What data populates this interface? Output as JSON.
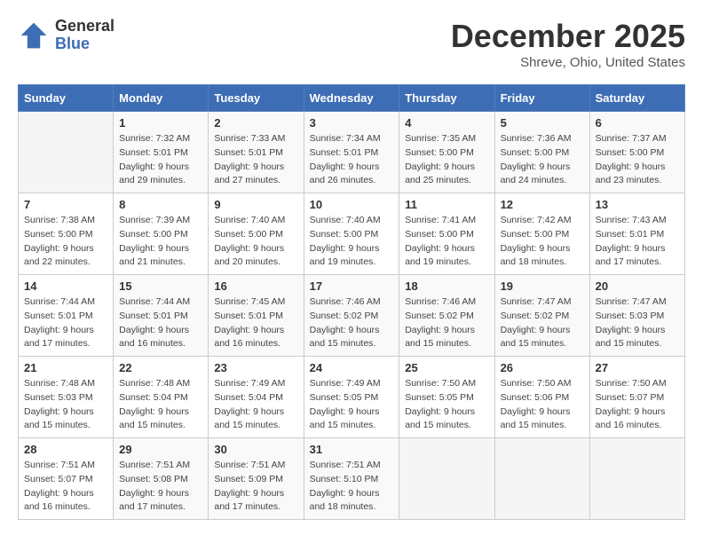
{
  "header": {
    "logo_line1": "General",
    "logo_line2": "Blue",
    "month": "December 2025",
    "location": "Shreve, Ohio, United States"
  },
  "weekdays": [
    "Sunday",
    "Monday",
    "Tuesday",
    "Wednesday",
    "Thursday",
    "Friday",
    "Saturday"
  ],
  "weeks": [
    [
      {
        "day": "",
        "sunrise": "",
        "sunset": "",
        "daylight": ""
      },
      {
        "day": "1",
        "sunrise": "Sunrise: 7:32 AM",
        "sunset": "Sunset: 5:01 PM",
        "daylight": "Daylight: 9 hours and 29 minutes."
      },
      {
        "day": "2",
        "sunrise": "Sunrise: 7:33 AM",
        "sunset": "Sunset: 5:01 PM",
        "daylight": "Daylight: 9 hours and 27 minutes."
      },
      {
        "day": "3",
        "sunrise": "Sunrise: 7:34 AM",
        "sunset": "Sunset: 5:01 PM",
        "daylight": "Daylight: 9 hours and 26 minutes."
      },
      {
        "day": "4",
        "sunrise": "Sunrise: 7:35 AM",
        "sunset": "Sunset: 5:00 PM",
        "daylight": "Daylight: 9 hours and 25 minutes."
      },
      {
        "day": "5",
        "sunrise": "Sunrise: 7:36 AM",
        "sunset": "Sunset: 5:00 PM",
        "daylight": "Daylight: 9 hours and 24 minutes."
      },
      {
        "day": "6",
        "sunrise": "Sunrise: 7:37 AM",
        "sunset": "Sunset: 5:00 PM",
        "daylight": "Daylight: 9 hours and 23 minutes."
      }
    ],
    [
      {
        "day": "7",
        "sunrise": "Sunrise: 7:38 AM",
        "sunset": "Sunset: 5:00 PM",
        "daylight": "Daylight: 9 hours and 22 minutes."
      },
      {
        "day": "8",
        "sunrise": "Sunrise: 7:39 AM",
        "sunset": "Sunset: 5:00 PM",
        "daylight": "Daylight: 9 hours and 21 minutes."
      },
      {
        "day": "9",
        "sunrise": "Sunrise: 7:40 AM",
        "sunset": "Sunset: 5:00 PM",
        "daylight": "Daylight: 9 hours and 20 minutes."
      },
      {
        "day": "10",
        "sunrise": "Sunrise: 7:40 AM",
        "sunset": "Sunset: 5:00 PM",
        "daylight": "Daylight: 9 hours and 19 minutes."
      },
      {
        "day": "11",
        "sunrise": "Sunrise: 7:41 AM",
        "sunset": "Sunset: 5:00 PM",
        "daylight": "Daylight: 9 hours and 19 minutes."
      },
      {
        "day": "12",
        "sunrise": "Sunrise: 7:42 AM",
        "sunset": "Sunset: 5:00 PM",
        "daylight": "Daylight: 9 hours and 18 minutes."
      },
      {
        "day": "13",
        "sunrise": "Sunrise: 7:43 AM",
        "sunset": "Sunset: 5:01 PM",
        "daylight": "Daylight: 9 hours and 17 minutes."
      }
    ],
    [
      {
        "day": "14",
        "sunrise": "Sunrise: 7:44 AM",
        "sunset": "Sunset: 5:01 PM",
        "daylight": "Daylight: 9 hours and 17 minutes."
      },
      {
        "day": "15",
        "sunrise": "Sunrise: 7:44 AM",
        "sunset": "Sunset: 5:01 PM",
        "daylight": "Daylight: 9 hours and 16 minutes."
      },
      {
        "day": "16",
        "sunrise": "Sunrise: 7:45 AM",
        "sunset": "Sunset: 5:01 PM",
        "daylight": "Daylight: 9 hours and 16 minutes."
      },
      {
        "day": "17",
        "sunrise": "Sunrise: 7:46 AM",
        "sunset": "Sunset: 5:02 PM",
        "daylight": "Daylight: 9 hours and 15 minutes."
      },
      {
        "day": "18",
        "sunrise": "Sunrise: 7:46 AM",
        "sunset": "Sunset: 5:02 PM",
        "daylight": "Daylight: 9 hours and 15 minutes."
      },
      {
        "day": "19",
        "sunrise": "Sunrise: 7:47 AM",
        "sunset": "Sunset: 5:02 PM",
        "daylight": "Daylight: 9 hours and 15 minutes."
      },
      {
        "day": "20",
        "sunrise": "Sunrise: 7:47 AM",
        "sunset": "Sunset: 5:03 PM",
        "daylight": "Daylight: 9 hours and 15 minutes."
      }
    ],
    [
      {
        "day": "21",
        "sunrise": "Sunrise: 7:48 AM",
        "sunset": "Sunset: 5:03 PM",
        "daylight": "Daylight: 9 hours and 15 minutes."
      },
      {
        "day": "22",
        "sunrise": "Sunrise: 7:48 AM",
        "sunset": "Sunset: 5:04 PM",
        "daylight": "Daylight: 9 hours and 15 minutes."
      },
      {
        "day": "23",
        "sunrise": "Sunrise: 7:49 AM",
        "sunset": "Sunset: 5:04 PM",
        "daylight": "Daylight: 9 hours and 15 minutes."
      },
      {
        "day": "24",
        "sunrise": "Sunrise: 7:49 AM",
        "sunset": "Sunset: 5:05 PM",
        "daylight": "Daylight: 9 hours and 15 minutes."
      },
      {
        "day": "25",
        "sunrise": "Sunrise: 7:50 AM",
        "sunset": "Sunset: 5:05 PM",
        "daylight": "Daylight: 9 hours and 15 minutes."
      },
      {
        "day": "26",
        "sunrise": "Sunrise: 7:50 AM",
        "sunset": "Sunset: 5:06 PM",
        "daylight": "Daylight: 9 hours and 15 minutes."
      },
      {
        "day": "27",
        "sunrise": "Sunrise: 7:50 AM",
        "sunset": "Sunset: 5:07 PM",
        "daylight": "Daylight: 9 hours and 16 minutes."
      }
    ],
    [
      {
        "day": "28",
        "sunrise": "Sunrise: 7:51 AM",
        "sunset": "Sunset: 5:07 PM",
        "daylight": "Daylight: 9 hours and 16 minutes."
      },
      {
        "day": "29",
        "sunrise": "Sunrise: 7:51 AM",
        "sunset": "Sunset: 5:08 PM",
        "daylight": "Daylight: 9 hours and 17 minutes."
      },
      {
        "day": "30",
        "sunrise": "Sunrise: 7:51 AM",
        "sunset": "Sunset: 5:09 PM",
        "daylight": "Daylight: 9 hours and 17 minutes."
      },
      {
        "day": "31",
        "sunrise": "Sunrise: 7:51 AM",
        "sunset": "Sunset: 5:10 PM",
        "daylight": "Daylight: 9 hours and 18 minutes."
      },
      {
        "day": "",
        "sunrise": "",
        "sunset": "",
        "daylight": ""
      },
      {
        "day": "",
        "sunrise": "",
        "sunset": "",
        "daylight": ""
      },
      {
        "day": "",
        "sunrise": "",
        "sunset": "",
        "daylight": ""
      }
    ]
  ]
}
